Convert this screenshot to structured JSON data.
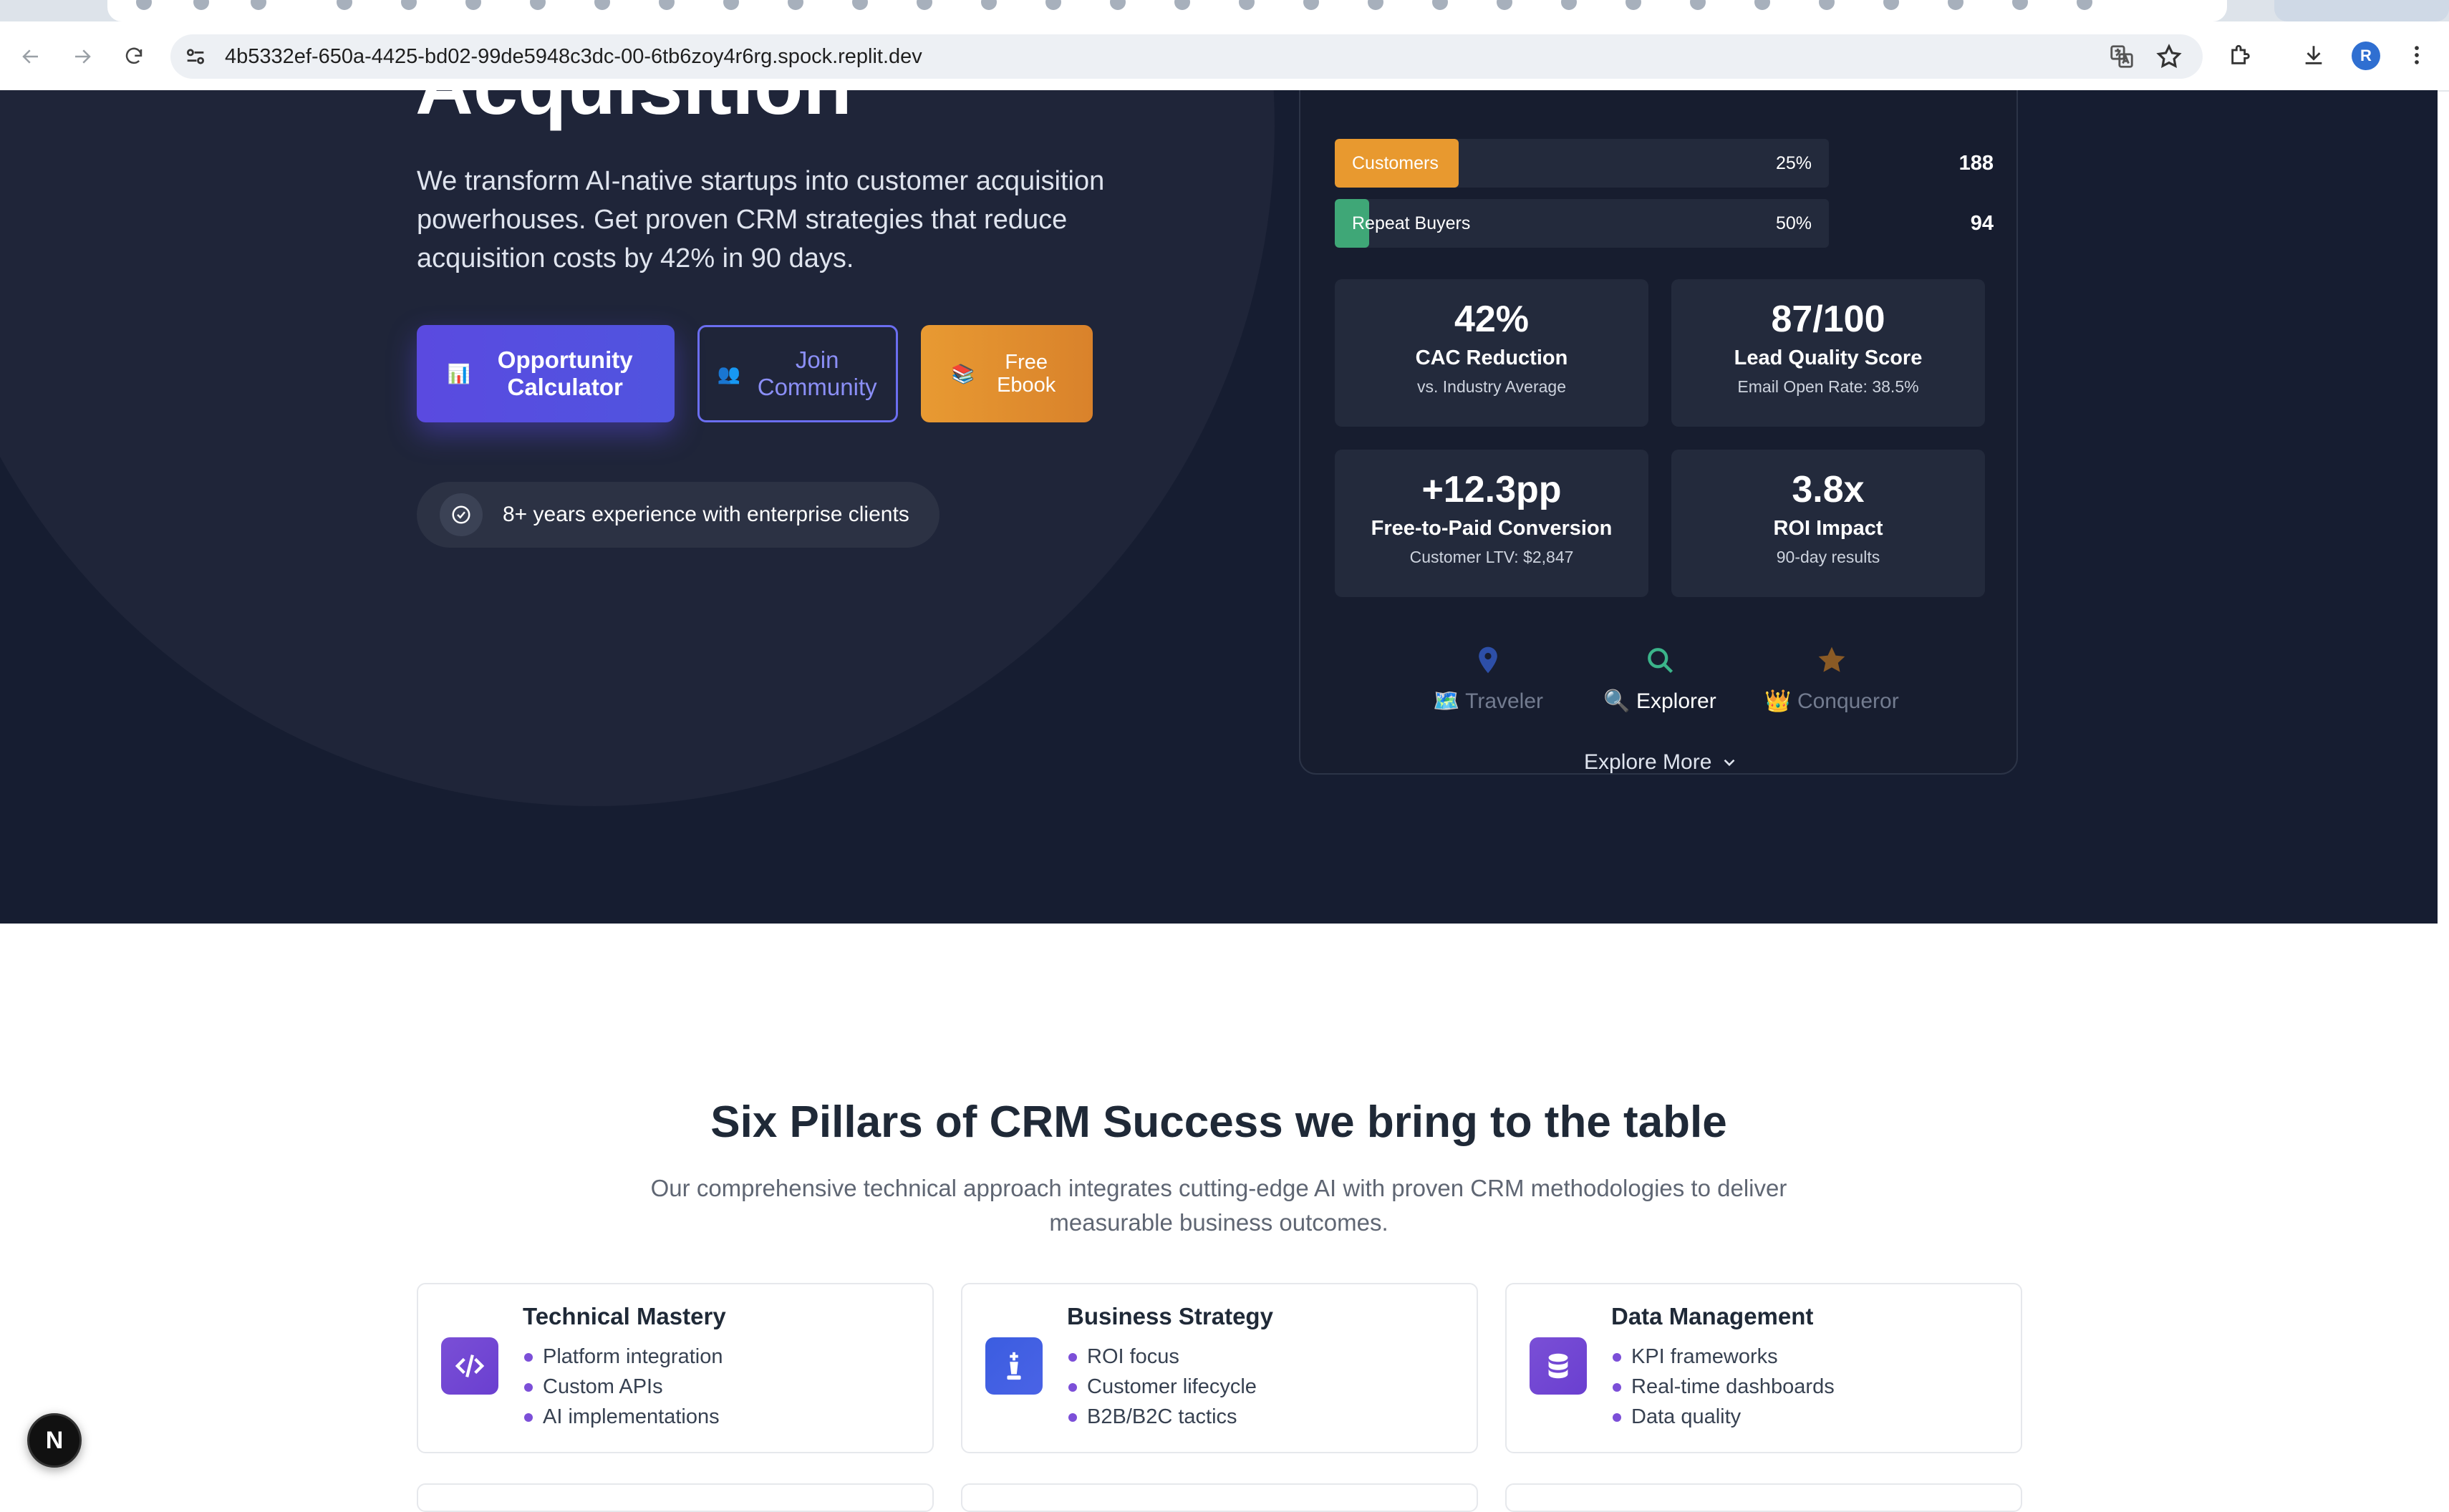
{
  "browser": {
    "url": "4b5332ef-650a-4425-bd02-99de5948c3dc-00-6tb6zoy4r6rg.spock.replit.dev",
    "profile_initial": "R"
  },
  "hero": {
    "headline": "Acquisition",
    "subheading": "We transform AI-native startups into customer acquisition powerhouses. Get proven CRM strategies that reduce acquisition costs by 42% in 90 days.",
    "buttons": {
      "calculator": {
        "emoji": "📊",
        "label": "Opportunity Calculator"
      },
      "community": {
        "emoji": "👥",
        "label": "Join Community"
      },
      "ebook": {
        "emoji": "📚",
        "label": "Free Ebook"
      }
    },
    "badge_text": "8+ years experience with enterprise clients"
  },
  "funnel": [
    {
      "label": "Customers",
      "percent": "25%",
      "count": "188",
      "fill": 0.25,
      "color": "#e8992f"
    },
    {
      "label": "Repeat Buyers",
      "percent": "50%",
      "count": "94",
      "fill": 0.07,
      "color": "#3fa777"
    }
  ],
  "stats": [
    {
      "value": "42%",
      "label": "CAC Reduction",
      "sub": "vs. Industry Average"
    },
    {
      "value": "87/100",
      "label": "Lead Quality Score",
      "sub": "Email Open Rate: 38.5%"
    },
    {
      "value": "+12.3pp",
      "label": "Free-to-Paid Conversion",
      "sub": "Customer LTV: $2,847"
    },
    {
      "value": "3.8x",
      "label": "ROI Impact",
      "sub": "90-day results"
    }
  ],
  "personas": [
    {
      "emoji_label": "🗺️ Traveler",
      "icon": "map-pin-icon",
      "active": false
    },
    {
      "emoji_label": "🔍 Explorer",
      "icon": "search-icon",
      "active": true
    },
    {
      "emoji_label": "👑 Conqueror",
      "icon": "star-icon",
      "active": false
    }
  ],
  "explore_more": "Explore More",
  "pillars": {
    "title": "Six Pillars of CRM Success we bring to the table",
    "subtitle": "Our comprehensive technical approach integrates cutting-edge AI with proven CRM methodologies to deliver measurable business outcomes.",
    "cards": [
      {
        "title": "Technical Mastery",
        "icon": "code-icon",
        "items": [
          "Platform integration",
          "Custom APIs",
          "AI implementations"
        ]
      },
      {
        "title": "Business Strategy",
        "icon": "chess-king-icon",
        "items": [
          "ROI focus",
          "Customer lifecycle",
          "B2B/B2C tactics"
        ]
      },
      {
        "title": "Data Management",
        "icon": "database-icon",
        "items": [
          "KPI frameworks",
          "Real-time dashboards",
          "Data quality"
        ]
      }
    ]
  },
  "colors": {
    "hero_bg": "#161d31",
    "accent_purple": "#5a4ae0",
    "accent_orange": "#e8992f",
    "bullet": "#7c4fd8"
  },
  "dev_badge": "N"
}
